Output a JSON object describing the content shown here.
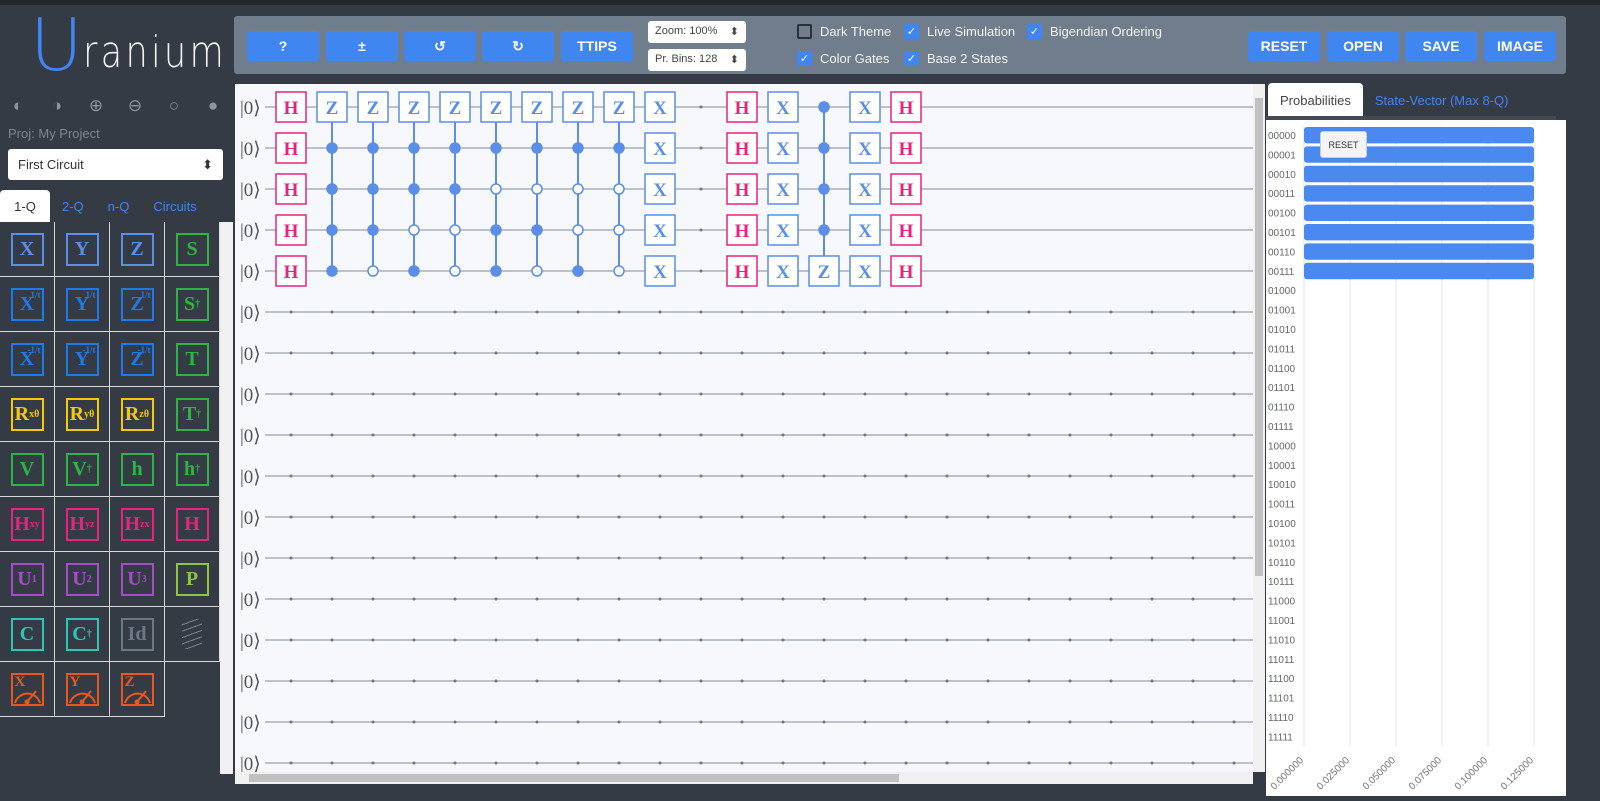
{
  "app": {
    "logo_first": "U",
    "logo_rest": "ranium"
  },
  "theme_icons": [
    "half-circle-left-icon",
    "half-circle-right-icon",
    "circle-plus-icon",
    "circle-minus-icon",
    "circle-empty-icon",
    "circle-filled-icon"
  ],
  "theme_glyphs": [
    "◐",
    "◑",
    "⊕",
    "⊖",
    "○",
    "●"
  ],
  "project": {
    "label": "Proj:",
    "name": "My Project",
    "circuit": "First Circuit"
  },
  "palette_tabs": [
    "1-Q",
    "2-Q",
    "n-Q",
    "Circuits"
  ],
  "palette": [
    {
      "t": "X",
      "c": "#5b8ee6"
    },
    {
      "t": "Y",
      "c": "#5b8ee6"
    },
    {
      "t": "Z",
      "c": "#5b8ee6"
    },
    {
      "t": "S",
      "c": "#2fb344"
    },
    {
      "t": "X",
      "sup": "1/t",
      "c": "#1e7ae8"
    },
    {
      "t": "Y",
      "sup": "1/t",
      "c": "#1e7ae8"
    },
    {
      "t": "Z",
      "sup": "1/t",
      "c": "#1e7ae8"
    },
    {
      "t": "S",
      "sup": "†",
      "c": "#2fb344"
    },
    {
      "t": "X",
      "sup": "-1/t",
      "c": "#1e7ae8"
    },
    {
      "t": "Y",
      "sup": "-1/t",
      "c": "#1e7ae8"
    },
    {
      "t": "Z",
      "sup": "-1/t",
      "c": "#1e7ae8"
    },
    {
      "t": "T",
      "c": "#2fb344"
    },
    {
      "t": "R",
      "sub": "x",
      "sup": "θ",
      "c": "#f2c811"
    },
    {
      "t": "R",
      "sub": "y",
      "sup": "θ",
      "c": "#f2c811"
    },
    {
      "t": "R",
      "sub": "z",
      "sup": "θ",
      "c": "#f2c811"
    },
    {
      "t": "T",
      "sup": "†",
      "c": "#2fb344"
    },
    {
      "t": "V",
      "c": "#2fb344"
    },
    {
      "t": "V",
      "sup": "†",
      "c": "#2fb344"
    },
    {
      "t": "h",
      "c": "#2fb344"
    },
    {
      "t": "h",
      "sup": "†",
      "c": "#2fb344"
    },
    {
      "t": "H",
      "sub": "xy",
      "c": "#e6247f"
    },
    {
      "t": "H",
      "sub": "yz",
      "c": "#e6247f"
    },
    {
      "t": "H",
      "sub": "zx",
      "c": "#e6247f"
    },
    {
      "t": "H",
      "c": "#e6247f"
    },
    {
      "t": "U",
      "sub": "1",
      "c": "#a24fc6"
    },
    {
      "t": "U",
      "sub": "2",
      "c": "#a24fc6"
    },
    {
      "t": "U",
      "sub": "3",
      "c": "#a24fc6"
    },
    {
      "t": "P",
      "c": "#8cc63e"
    },
    {
      "t": "C",
      "c": "#2ec4b6"
    },
    {
      "t": "C",
      "sup": "†",
      "c": "#2ec4b6"
    },
    {
      "t": "Id",
      "c": "#6b7785"
    },
    {
      "t": "barrier",
      "c": "#7a8492"
    },
    {
      "t": "X",
      "meter": true,
      "c": "#e8581c"
    },
    {
      "t": "Y",
      "meter": true,
      "c": "#e8581c"
    },
    {
      "t": "Z",
      "meter": true,
      "c": "#e8581c"
    }
  ],
  "toolbar": {
    "buttons": [
      "?",
      "±",
      "↺",
      "↻",
      "TTIPS"
    ],
    "right_buttons": [
      "RESET",
      "OPEN",
      "SAVE",
      "IMAGE"
    ],
    "zoom": "Zoom: 100%",
    "bins": "Pr. Bins: 128",
    "checks": [
      {
        "label": "Dark Theme",
        "on": false
      },
      {
        "label": "Live Simulation",
        "on": true
      },
      {
        "label": "Bigendian Ordering",
        "on": true
      },
      {
        "label": "Color Gates",
        "on": true
      },
      {
        "label": "Base 2 States",
        "on": true
      }
    ]
  },
  "circuit": {
    "wire_label": "|0⟩",
    "num_wires": 17,
    "num_columns": 24,
    "colors": {
      "blue": "#5b8ee6",
      "pink": "#e6247f"
    },
    "gates": [
      {
        "col": 0,
        "rows": [
          0,
          1,
          2,
          3,
          4
        ],
        "t": "H"
      },
      {
        "col": 1,
        "t": "Z",
        "target": 0,
        "ctrl": [
          1,
          1,
          1,
          1
        ]
      },
      {
        "col": 2,
        "t": "Z",
        "target": 0,
        "ctrl": [
          1,
          1,
          1,
          0
        ]
      },
      {
        "col": 3,
        "t": "Z",
        "target": 0,
        "ctrl": [
          1,
          1,
          0,
          1
        ]
      },
      {
        "col": 4,
        "t": "Z",
        "target": 0,
        "ctrl": [
          1,
          1,
          0,
          0
        ]
      },
      {
        "col": 5,
        "t": "Z",
        "target": 0,
        "ctrl": [
          1,
          0,
          1,
          1
        ]
      },
      {
        "col": 6,
        "t": "Z",
        "target": 0,
        "ctrl": [
          1,
          0,
          1,
          0
        ]
      },
      {
        "col": 7,
        "t": "Z",
        "target": 0,
        "ctrl": [
          1,
          0,
          0,
          1
        ]
      },
      {
        "col": 8,
        "t": "Z",
        "target": 0,
        "ctrl": [
          1,
          0,
          0,
          0
        ]
      },
      {
        "col": 9,
        "rows": [
          0,
          1,
          2,
          3,
          4
        ],
        "t": "X"
      },
      {
        "col": 11,
        "rows": [
          0,
          1,
          2,
          3,
          4
        ],
        "t": "H"
      },
      {
        "col": 12,
        "rows": [
          0,
          1,
          2,
          3,
          4
        ],
        "t": "X"
      },
      {
        "col": 13,
        "t": "Z",
        "target": 4,
        "ctrlrows": [
          0,
          1,
          2,
          3
        ]
      },
      {
        "col": 14,
        "rows": [
          0,
          1,
          2,
          3,
          4
        ],
        "t": "X"
      },
      {
        "col": 15,
        "rows": [
          0,
          1,
          2,
          3,
          4
        ],
        "t": "H"
      }
    ]
  },
  "results": {
    "tabs": [
      "Probabilities",
      "State-Vector (Max 8-Q)"
    ],
    "reset_label": "RESET"
  },
  "chart_data": {
    "type": "bar",
    "orientation": "horizontal",
    "categories": [
      "00000",
      "00001",
      "00010",
      "00011",
      "00100",
      "00101",
      "00110",
      "00111",
      "01000",
      "01001",
      "01010",
      "01011",
      "01100",
      "01101",
      "01110",
      "01111",
      "10000",
      "10001",
      "10010",
      "10011",
      "10100",
      "10101",
      "10110",
      "10111",
      "11000",
      "11001",
      "11010",
      "11011",
      "11100",
      "11101",
      "11110",
      "11111"
    ],
    "values": [
      0.125,
      0.125,
      0.125,
      0.125,
      0.125,
      0.125,
      0.125,
      0.125,
      0,
      0,
      0,
      0,
      0,
      0,
      0,
      0,
      0,
      0,
      0,
      0,
      0,
      0,
      0,
      0,
      0,
      0,
      0,
      0,
      0,
      0,
      0,
      0
    ],
    "xlim": [
      0,
      0.125
    ],
    "xticks": [
      "0.000000",
      "0.025000",
      "0.050000",
      "0.075000",
      "0.100000",
      "0.125000"
    ],
    "bar_color": "#4a89f0",
    "grid": true
  }
}
